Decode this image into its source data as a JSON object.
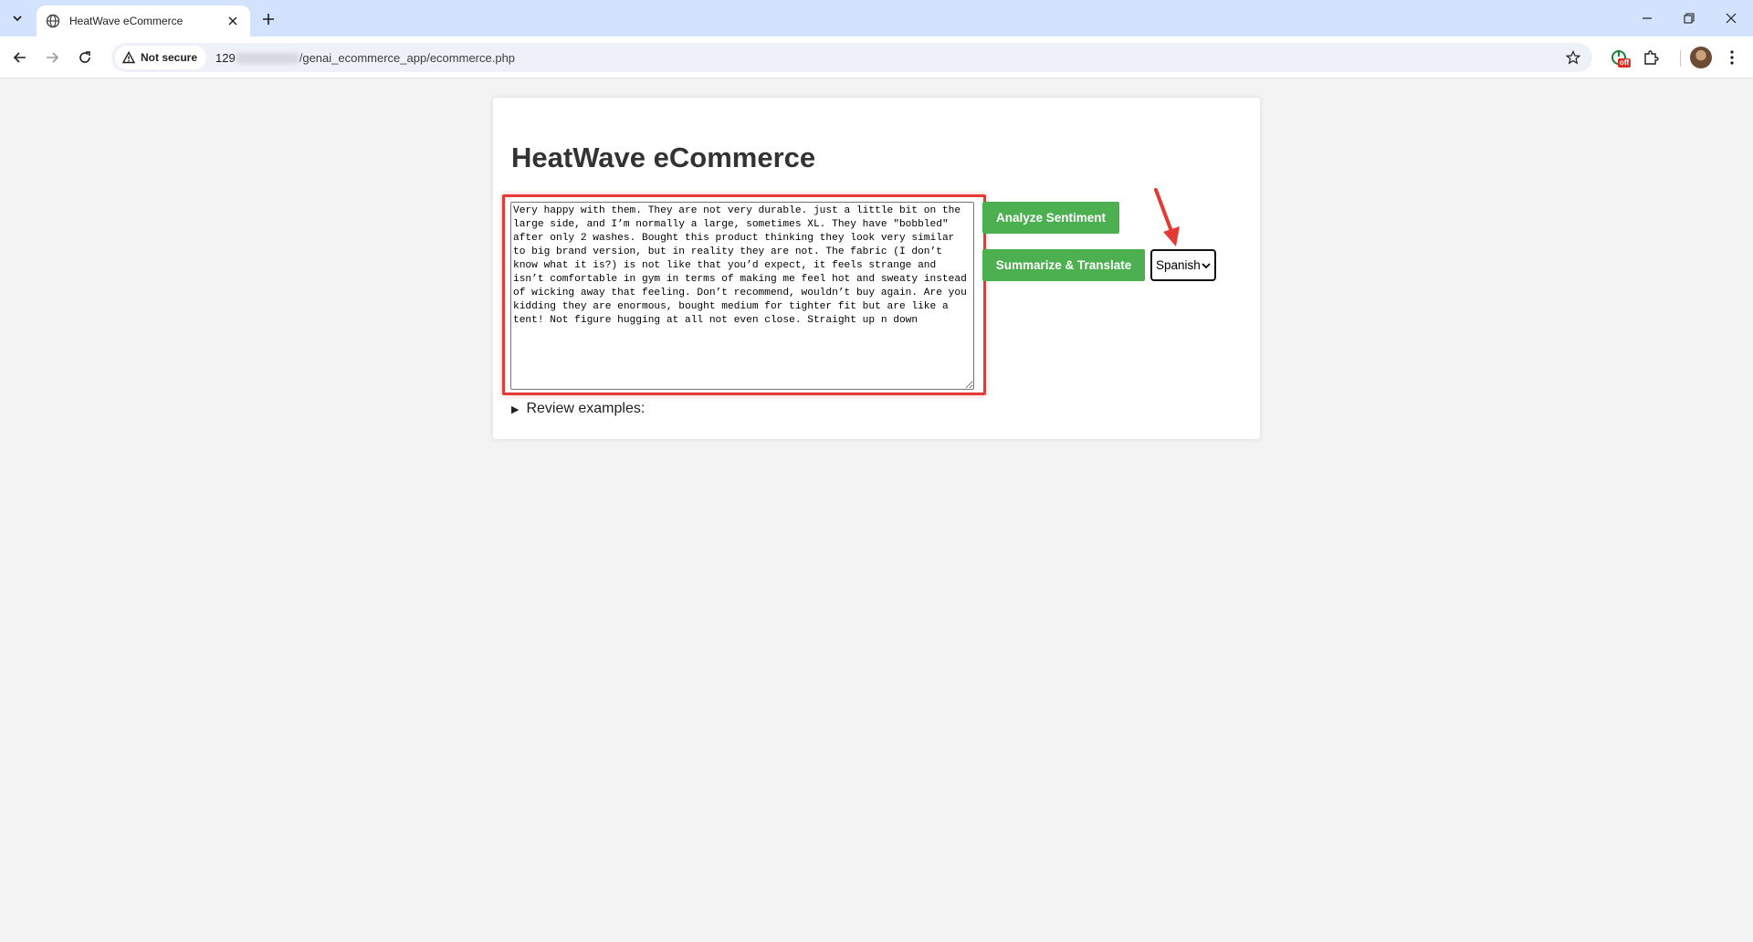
{
  "browser": {
    "tab_title": "HeatWave eCommerce",
    "security_label": "Not secure",
    "url_prefix": "129",
    "url_path": "/genai_ecommerce_app/ecommerce.php",
    "extension_badge": "off"
  },
  "page": {
    "title": "HeatWave eCommerce",
    "review_text": "Very happy with them. They are not very durable. just a little bit on the large side, and I’m normally a large, sometimes XL. They have \"bobbled\" after only 2 washes. Bought this product thinking they look very similar to big brand version, but in reality they are not. The fabric (I don’t know what it is?) is not like that you’d expect, it feels strange and isn’t comfortable in gym in terms of making me feel hot and sweaty instead of wicking away that feeling. Don’t recommend, wouldn’t buy again. Are you kidding they are enormous, bought medium for tighter fit but are like a tent! Not figure hugging at all not even close. Straight up n down",
    "analyze_button": "Analyze Sentiment",
    "summarize_button": "Summarize & Translate",
    "language_selected": "Spanish",
    "review_examples_label": "Review examples:"
  },
  "colors": {
    "button_green": "#4caf50",
    "highlight_red": "#e53935",
    "tabstrip_blue": "#d3e3fd"
  }
}
